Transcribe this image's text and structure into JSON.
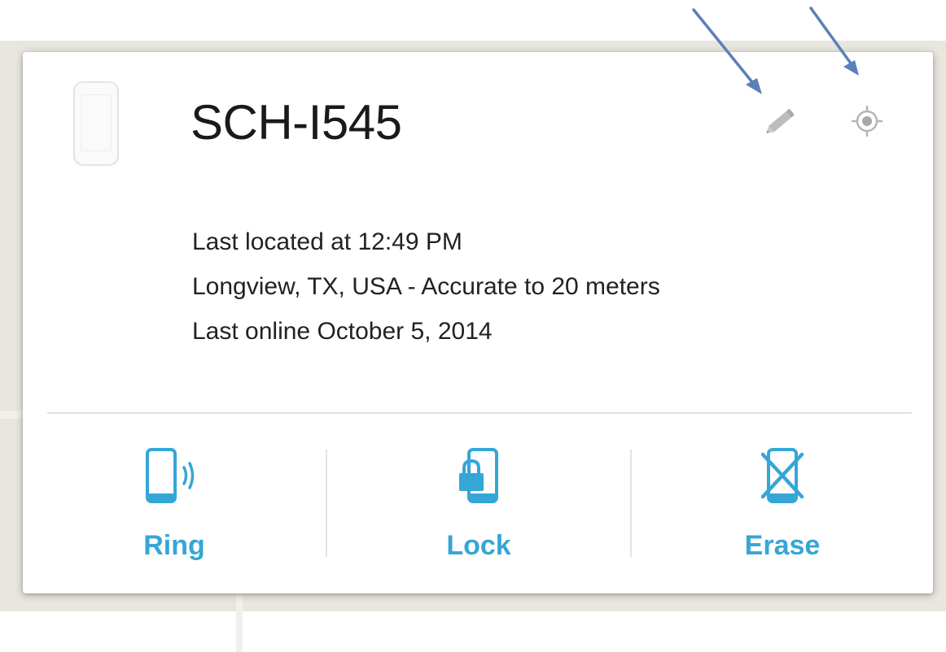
{
  "device": {
    "name": "SCH-I545",
    "last_located": "Last located at 12:49 PM",
    "location": "Longview, TX, USA - Accurate to 20 meters",
    "last_online": "Last online October 5, 2014"
  },
  "header_icons": [
    {
      "name": "pencil-icon",
      "semantic": "edit-device-name"
    },
    {
      "name": "crosshair-icon",
      "semantic": "locate-device"
    }
  ],
  "actions": [
    {
      "label": "Ring",
      "icon": "phone-ring-icon"
    },
    {
      "label": "Lock",
      "icon": "phone-lock-icon"
    },
    {
      "label": "Erase",
      "icon": "phone-erase-icon"
    }
  ],
  "colors": {
    "accent": "#35a6d6",
    "annotation_arrow": "#5b7fb8",
    "icon_gray": "#b5b5b5"
  }
}
